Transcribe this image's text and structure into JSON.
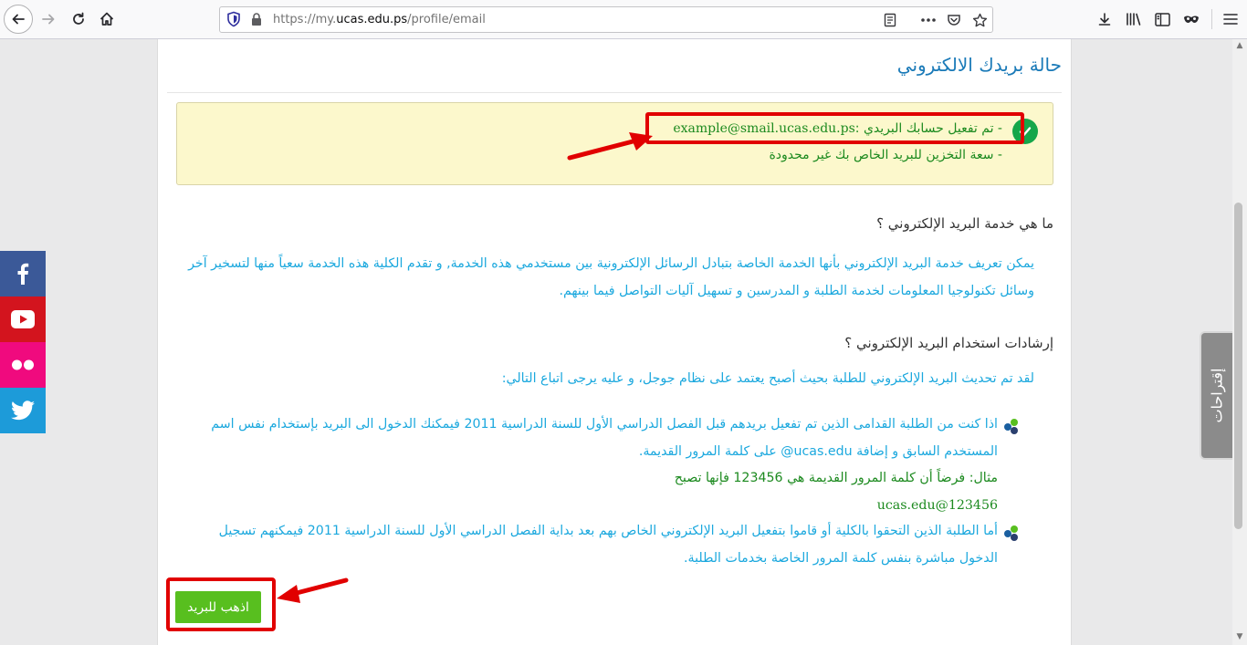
{
  "browser": {
    "url_prefix": "https://my.",
    "url_domain": "ucas.edu.ps",
    "url_path": "/profile/email"
  },
  "page": {
    "title": "حالة بريدك الالكتروني",
    "alert": {
      "line1_prefix": "- تم تفعيل حسابك البريدي :",
      "email": "example@smail.ucas.edu.ps",
      "line2": "- سعة التخزين للبريد الخاص بك غير محدودة"
    },
    "section1": {
      "heading": "ما هي خدمة البريد الإلكتروني ؟",
      "paragraph": "يمكن تعريف خدمة البريد الإلكتروني بأنها الخدمة الخاصة بتبادل الرسائل الإلكترونية بين مستخدمي هذه الخدمة, و تقدم الكلية هذه الخدمة سعياً منها لتسخير آخر وسائل تكنولوجيا المعلومات لخدمة الطلبة و المدرسين و تسهيل آليات التواصل فيما بينهم."
    },
    "section2": {
      "heading": "إرشادات استخدام البريد الإلكتروني ؟",
      "intro": "لقد تم تحديث البريد الإلكتروني للطلبة بحيث أصبح يعتمد على نظام جوجل، و عليه يرجى اتباع التالي:",
      "bullet1": "اذا كنت من الطلبة القدامى الذين تم تفعيل بريدهم قبل الفصل الدراسي الأول للسنة الدراسية 2011 فيمكنك الدخول الى البريد بإستخدام نفس اسم المستخدم السابق و إضافة ucas.edu@ على كلمة المرور القديمة.",
      "example_line": "مثال: فرضاً أن كلمة المرور القديمة هي 123456 فإنها تصبح",
      "example_value": "ucas.edu@123456",
      "bullet2": "أما الطلبة الذين التحقوا بالكلية أو قاموا بتفعيل البريد الإلكتروني الخاص بهم بعد بداية الفصل الدراسي الأول للسنة الدراسية 2011 فيمكنهم تسجيل الدخول مباشرة بنفس كلمة المرور الخاصة بخدمات الطلبة."
    },
    "go_button": "اذهب للبريد",
    "suggestions_tab": "إقتراحات"
  },
  "social": {
    "items": [
      "facebook",
      "youtube",
      "flickr",
      "twitter"
    ],
    "colors": {
      "facebook": "#3b5998",
      "youtube": "#d3141e",
      "flickr": "#f00a7e",
      "twitter": "#1d9bd9"
    }
  },
  "colors": {
    "title": "#1a7ab8",
    "link_text": "#1ba8de",
    "success_text": "#1c8a1f",
    "alert_bg": "#fcf8cc",
    "button_bg": "#58bf1f",
    "annotation_red": "#e10000"
  }
}
